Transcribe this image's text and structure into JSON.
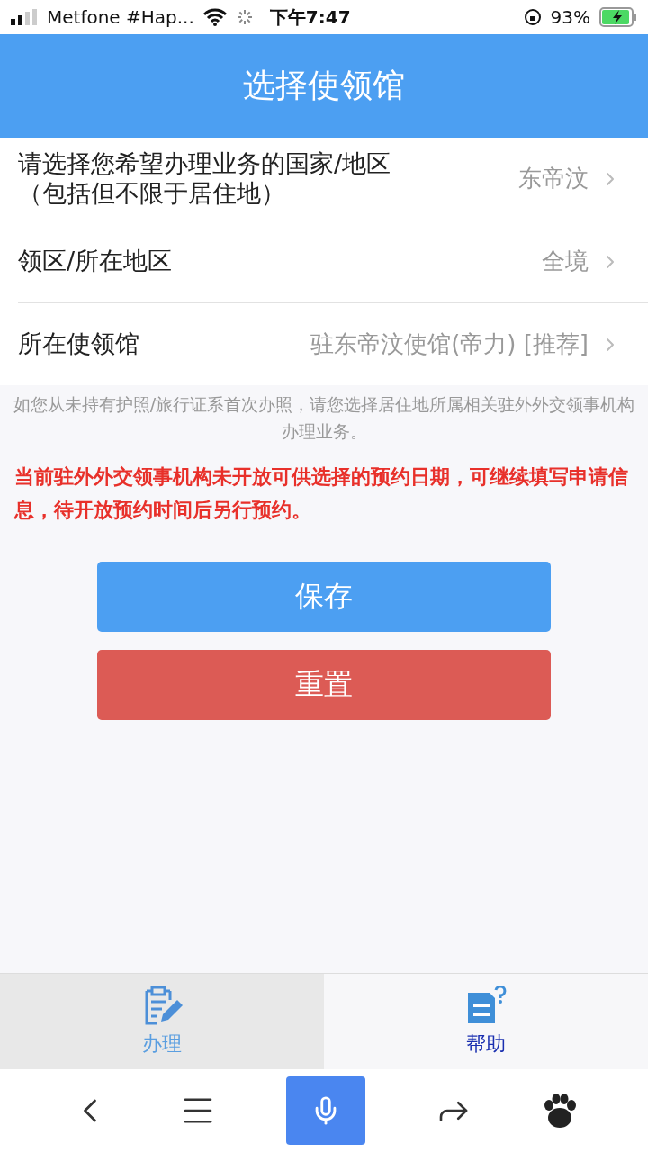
{
  "status_bar": {
    "carrier": "Metfone #Hap...",
    "time": "下午7:47",
    "battery": "93%"
  },
  "header": {
    "title": "选择使领馆"
  },
  "rows": [
    {
      "label": "请选择您希望办理业务的国家/地区",
      "note": "（包括但不限于居住地）",
      "value": "东帝汶"
    },
    {
      "label": "领区/所在地区",
      "value": "全境"
    },
    {
      "label": "所在使领馆",
      "value": "驻东帝汶使馆(帝力) [推荐]"
    }
  ],
  "hint": "如您从未持有护照/旅行证系首次办照，请您选择居住地所属相关驻外外交领事机构办理业务。",
  "warning": "当前驻外外交领事机构未开放可供选择的预约日期，可继续填写申请信息，待开放预约时间后另行预约。",
  "buttons": [
    {
      "label": "保存",
      "kind": "primary"
    },
    {
      "label": "重置",
      "kind": "danger"
    }
  ],
  "tabs": [
    {
      "label": "办理",
      "kind": "form",
      "selected": true
    },
    {
      "label": "帮助",
      "kind": "help",
      "selected": false
    }
  ]
}
